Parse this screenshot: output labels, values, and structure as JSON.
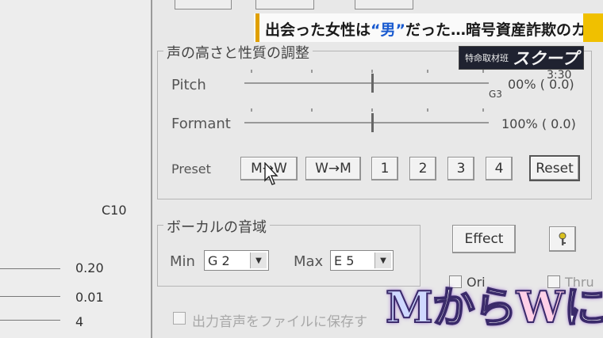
{
  "headline": {
    "text_a": "出会った女性は",
    "text_highlight": "“男”",
    "text_b": "だった…暗号資産詐欺のカラクリ"
  },
  "badge": {
    "small": "特命取材班",
    "large": "スクープ"
  },
  "clock": "3:30",
  "left_pane": {
    "top_label": "C10",
    "rows": [
      "0.20",
      "0.01",
      "4"
    ]
  },
  "voice_group": {
    "title": "声の高さと性質の調整",
    "pitch": {
      "label": "Pitch",
      "note": "G3",
      "value": "00% ( 0.0)"
    },
    "formant": {
      "label": "Formant",
      "value": "100% ( 0.0)"
    },
    "preset": {
      "label": "Preset",
      "buttons": [
        "M→W",
        "W→M",
        "1",
        "2",
        "3",
        "4"
      ],
      "reset": "Reset"
    }
  },
  "vocal_group": {
    "title": "ボーカルの音域",
    "min_label": "Min",
    "min_value": "G 2",
    "max_label": "Max",
    "max_value": "E 5"
  },
  "effect_button": "Effect",
  "help_icon": "key-icon",
  "checkboxes": {
    "original": "Ori",
    "thru": "Thru"
  },
  "save_option": "出力音声をファイルに保存す",
  "caption": {
    "m": "M",
    "mid": "から",
    "w": "W",
    "tail": "に"
  },
  "colors": {
    "headline_accent": "#1a5bd0",
    "stripe": "#e0a000",
    "badge_bg": "#1f2230"
  }
}
